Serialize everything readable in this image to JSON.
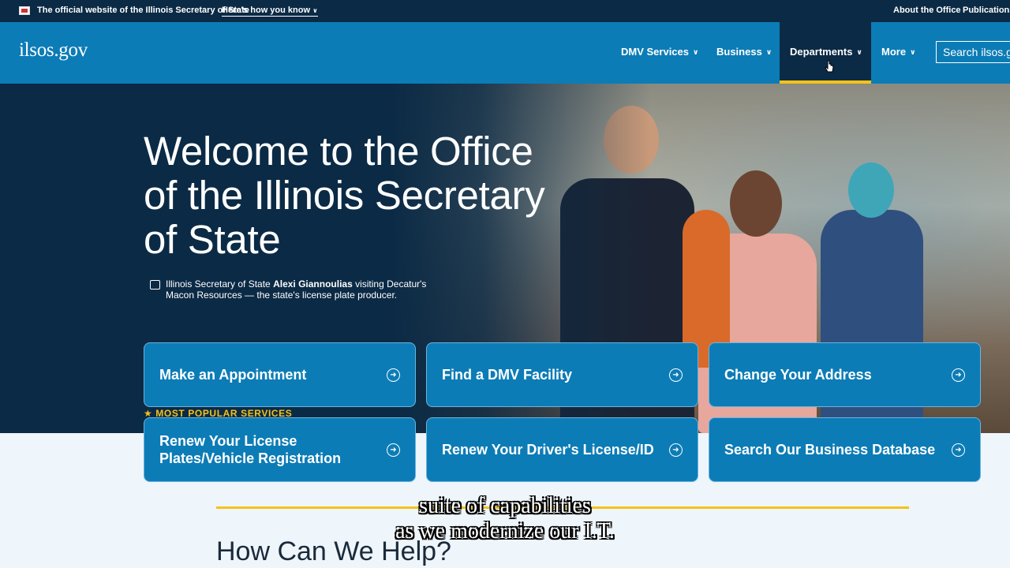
{
  "banner": {
    "official": "The official website of the Illinois Secretary of State",
    "how_you_know": "Here's how you know",
    "about": "About the Office",
    "publications": "Publications"
  },
  "header": {
    "logo": "ilsos.gov",
    "nav": [
      {
        "label": "DMV Services"
      },
      {
        "label": "Business"
      },
      {
        "label": "Departments",
        "active": true
      },
      {
        "label": "More"
      }
    ],
    "search_label": "Search ilsos.gov"
  },
  "hero": {
    "title": "Welcome to the Office of the Illinois Secretary of State",
    "caption_pre": "Illinois Secretary of State ",
    "caption_name": "Alexi Giannoulias",
    "caption_post": " visiting Decatur's Macon Resources — the state's license plate producer.",
    "popular_label": "MOST POPULAR SERVICES"
  },
  "services": [
    {
      "label": "Make an Appointment"
    },
    {
      "label": "Find a DMV Facility"
    },
    {
      "label": "Change Your Address"
    },
    {
      "label": "Renew Your License Plates/Vehicle Registration"
    },
    {
      "label": "Renew Your Driver's License/ID"
    },
    {
      "label": "Search Our Business Database"
    }
  ],
  "help_heading": "How Can We Help?",
  "subtitles": [
    "suite of capabilities",
    "as we modernize our I.T."
  ],
  "colors": {
    "navy": "#0b2a45",
    "blue": "#0c7cb6",
    "gold": "#f4c21a"
  }
}
